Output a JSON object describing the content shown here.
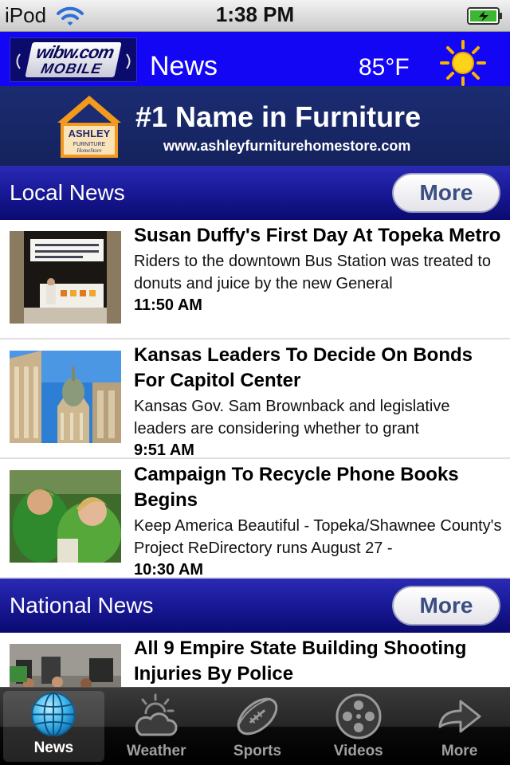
{
  "status_bar": {
    "carrier": "iPod",
    "time": "1:38 PM"
  },
  "header": {
    "logo_top": "wibw.com",
    "logo_bottom": "MOBILE",
    "title": "News",
    "temperature": "85°F",
    "weather_icon": "sun-icon"
  },
  "ad": {
    "logo_top": "ASHLEY",
    "logo_bottom": "FURNITURE",
    "logo_sub": "HomeStore",
    "headline": "#1 Name in Furniture",
    "url": "www.ashleyfurniturehomestore.com"
  },
  "sections": {
    "local": {
      "title": "Local News",
      "more_label": "More",
      "items": [
        {
          "title": "Susan Duffy's First Day At Topeka Metro",
          "summary": "Riders to the downtown Bus Station was treated to donuts and juice by the new General",
          "time": "11:50 AM"
        },
        {
          "title": "Kansas Leaders To Decide On Bonds For Capitol Center",
          "summary": "Kansas Gov. Sam Brownback and legislative leaders are considering whether to grant",
          "time": "9:51 AM"
        },
        {
          "title": "Campaign To Recycle Phone Books Begins",
          "summary": "Keep America Beautiful - Topeka/Shawnee County's Project ReDirectory runs August 27 -",
          "time": "10:30 AM"
        }
      ]
    },
    "national": {
      "title": "National News",
      "more_label": "More",
      "items": [
        {
          "title": "All 9 Empire State Building Shooting Injuries By Police",
          "summary": "",
          "time": ""
        }
      ]
    }
  },
  "tabs": [
    {
      "label": "News",
      "icon": "globe-icon",
      "active": true
    },
    {
      "label": "Weather",
      "icon": "weather-icon",
      "active": false
    },
    {
      "label": "Sports",
      "icon": "football-icon",
      "active": false
    },
    {
      "label": "Videos",
      "icon": "film-reel-icon",
      "active": false
    },
    {
      "label": "More",
      "icon": "arrow-icon",
      "active": false
    }
  ]
}
